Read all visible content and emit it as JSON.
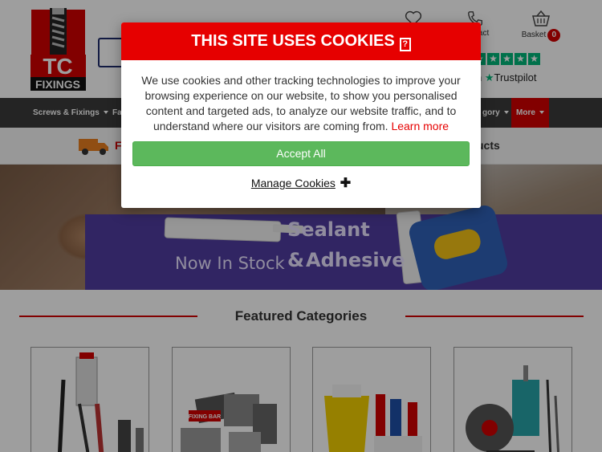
{
  "header": {
    "logo_text_top": "TC",
    "logo_text_bottom": "FIXINGS",
    "contact_label": "Contact",
    "basket_label": "Basket",
    "basket_count": "0",
    "trustpilot_label": "Trustpilot",
    "trustpilot_prefix": "n"
  },
  "nav": {
    "items": [
      {
        "label": "Screws & Fixings"
      },
      {
        "label": "Fa"
      },
      {
        "label": "gory"
      },
      {
        "label": "More"
      }
    ]
  },
  "delivery": {
    "text": "F",
    "right_text": "ucts"
  },
  "banner": {
    "headline_1": "Sealant &",
    "headline_2": "Adhesive",
    "subline": "Now In Stock"
  },
  "featured": {
    "title": "Featured Categories",
    "card_3_brand": "FIXING BAR"
  },
  "cookie_modal": {
    "title": "THIS SITE USES COOKIES",
    "body": "We use cookies and other tracking technologies to improve your browsing experience on our website, to show you personalised content and targeted ads, to analyze our website traffic, and to understand where our visitors are coming from.",
    "learn_more": "Learn more",
    "accept_label": "Accept All",
    "manage_label": "Manage Cookies",
    "manage_icon": "plus-icon"
  },
  "colors": {
    "brand_red": "#e60000",
    "nav_bg": "#3b3b3b",
    "accept_green": "#5cb85c",
    "trustpilot_green": "#00b67a"
  }
}
